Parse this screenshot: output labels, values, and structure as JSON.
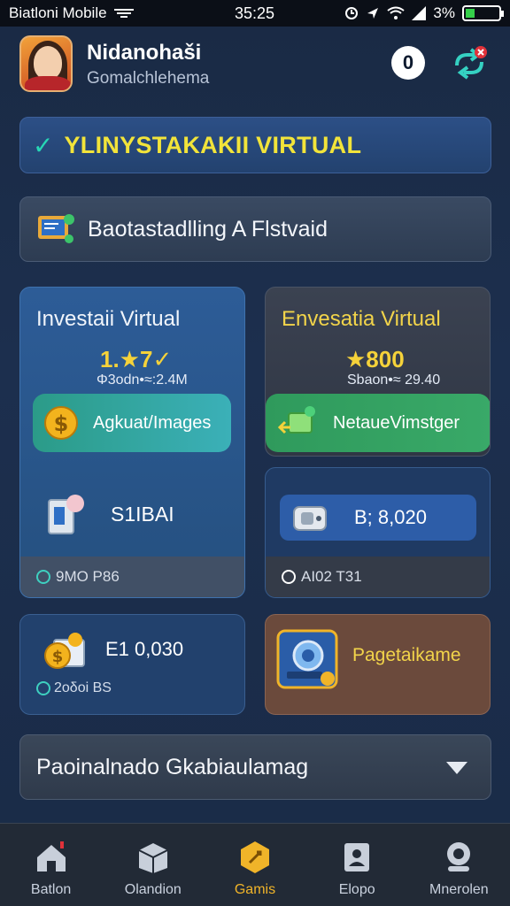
{
  "status_bar": {
    "carrier": "Biatloni Mobile",
    "time": "35:25",
    "battery_text": "3%"
  },
  "header": {
    "username": "Nidanohaši",
    "subtitle": "Gomalchlehema",
    "notification_count": "0"
  },
  "banners": {
    "virtual_title": "YLINYSTAKAKII VIRTUAL",
    "dashboard_title": "Baotastadlling A Flstvaid"
  },
  "cards": {
    "left_big": {
      "title": "Investaii Virtual",
      "amount": "1.★7✓",
      "amount_sub": "Φ3odn•≈:2.4M",
      "pill_label": "Agkuat/Images",
      "storage_label": "S1IBAI",
      "footer": "9MO P86"
    },
    "right_top": {
      "title": "Envesatia Virtual",
      "amount": "★800",
      "amount_sub": "Sbaon•≈ 29.40",
      "pill_label": "NetaueVimstger"
    },
    "right_mid": {
      "pill_label": "B; 8,020",
      "footer": "AI02 T31"
    },
    "left_small": {
      "amount": "E1 0,030",
      "sub": "2oδoi BS"
    },
    "right_small": {
      "label": "Pagetaikame"
    }
  },
  "dropdown": {
    "label": "Paoinalnado Gkabiaulamag"
  },
  "bottom_nav": [
    {
      "label": "Batlon",
      "icon": "home-icon"
    },
    {
      "label": "Olandion",
      "icon": "box-icon"
    },
    {
      "label": "Gamis",
      "icon": "game-icon"
    },
    {
      "label": "Elopo",
      "icon": "profile-card-icon"
    },
    {
      "label": "Mnerolen",
      "icon": "user-icon"
    }
  ],
  "colors": {
    "accent_yellow": "#f2e43a",
    "accent_teal": "#27d7b5",
    "active_nav": "#f0b429"
  }
}
